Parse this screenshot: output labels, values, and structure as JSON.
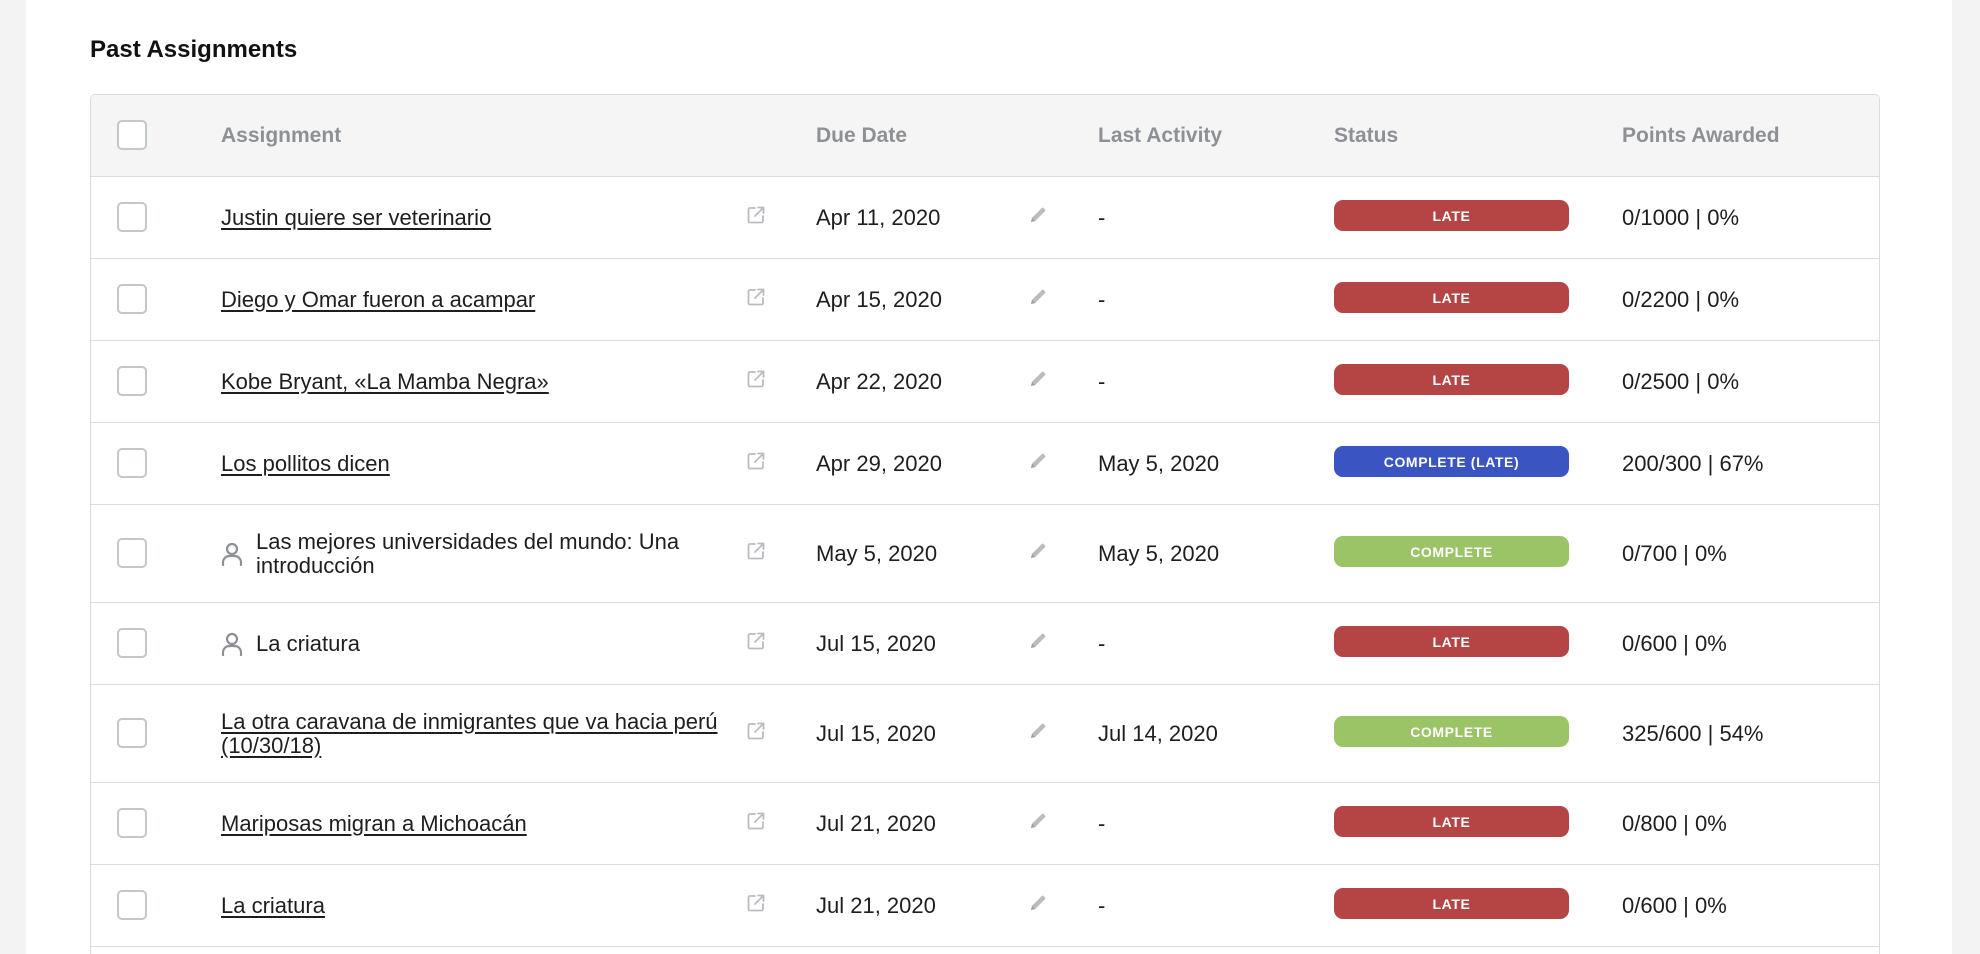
{
  "section_title": "Past Assignments",
  "columns": {
    "assignment": "Assignment",
    "due_date": "Due Date",
    "last_activity": "Last Activity",
    "status": "Status",
    "points_awarded": "Points Awarded"
  },
  "colors": {
    "late": "#b54545",
    "complete": "#9ac466",
    "complete_late": "#3a54c2"
  },
  "rows": [
    {
      "name": "Justin quiere ser veterinario",
      "link": true,
      "person": false,
      "due": "Apr 11, 2020",
      "activity": "-",
      "status": "LATE",
      "status_kind": "late",
      "points": "0/1000 | 0%"
    },
    {
      "name": "Diego y Omar fueron a acampar",
      "link": true,
      "person": false,
      "due": "Apr 15, 2020",
      "activity": "-",
      "status": "LATE",
      "status_kind": "late",
      "points": "0/2200 | 0%"
    },
    {
      "name": "Kobe Bryant, «La Mamba Negra»",
      "link": true,
      "person": false,
      "due": "Apr 22, 2020",
      "activity": "-",
      "status": "LATE",
      "status_kind": "late",
      "points": "0/2500 | 0%"
    },
    {
      "name": "Los pollitos dicen",
      "link": true,
      "person": false,
      "due": "Apr 29, 2020",
      "activity": "May 5, 2020",
      "status": "COMPLETE (LATE)",
      "status_kind": "complete_late",
      "points": "200/300 | 67%"
    },
    {
      "name": "Las mejores universidades del mundo: Una introducción",
      "link": false,
      "person": true,
      "due": "May 5, 2020",
      "activity": "May 5, 2020",
      "status": "COMPLETE",
      "status_kind": "complete",
      "points": "0/700 | 0%"
    },
    {
      "name": "La criatura",
      "link": false,
      "person": true,
      "due": "Jul 15, 2020",
      "activity": "-",
      "status": "LATE",
      "status_kind": "late",
      "points": "0/600 | 0%"
    },
    {
      "name": "La otra caravana de inmigrantes que va hacia perú (10/30/18)",
      "link": true,
      "person": false,
      "due": "Jul 15, 2020",
      "activity": "Jul 14, 2020",
      "status": "COMPLETE",
      "status_kind": "complete",
      "points": "325/600 | 54%"
    },
    {
      "name": "Mariposas migran a Michoacán",
      "link": true,
      "person": false,
      "due": "Jul 21, 2020",
      "activity": "-",
      "status": "LATE",
      "status_kind": "late",
      "points": "0/800 | 0%"
    },
    {
      "name": "La criatura",
      "link": true,
      "person": false,
      "due": "Jul 21, 2020",
      "activity": "-",
      "status": "LATE",
      "status_kind": "late",
      "points": "0/600 | 0%"
    }
  ]
}
